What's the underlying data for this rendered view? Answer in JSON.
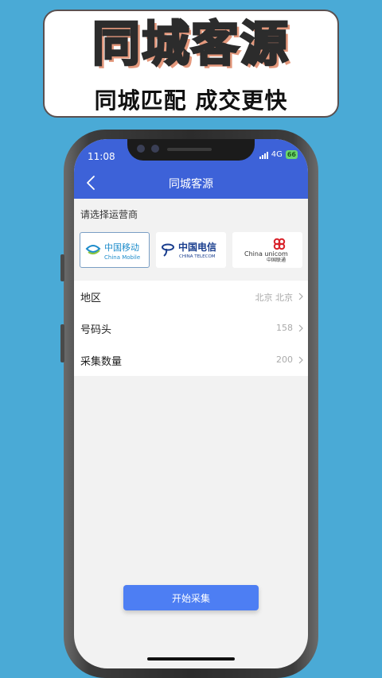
{
  "banner": {
    "title": "同城客源",
    "subtitle": "同城匹配 成交更快"
  },
  "status_bar": {
    "time": "11:08",
    "network": "4G",
    "battery": "66"
  },
  "nav": {
    "back_icon": "chevron-left-icon",
    "title": "同城客源"
  },
  "carrier_section": {
    "prompt": "请选择运营商",
    "carriers": [
      {
        "name_cn": "中国移动",
        "name_en": "China Mobile",
        "selected": true,
        "color": "#1d8ccb"
      },
      {
        "name_cn": "中国电信",
        "name_en": "CHINA TELECOM",
        "selected": false,
        "color": "#1a3e8e"
      },
      {
        "name_cn": "中国联通",
        "name_en": "China unicom",
        "selected": false,
        "color": "#d9222a"
      }
    ]
  },
  "form": {
    "rows": [
      {
        "label": "地区",
        "value": "北京 北京"
      },
      {
        "label": "号码头",
        "value": "158"
      },
      {
        "label": "采集数量",
        "value": "200"
      }
    ]
  },
  "actions": {
    "start_label": "开始采集"
  },
  "colors": {
    "background": "#4aaad6",
    "header": "#3d62d8",
    "button": "#4d7ef3"
  }
}
